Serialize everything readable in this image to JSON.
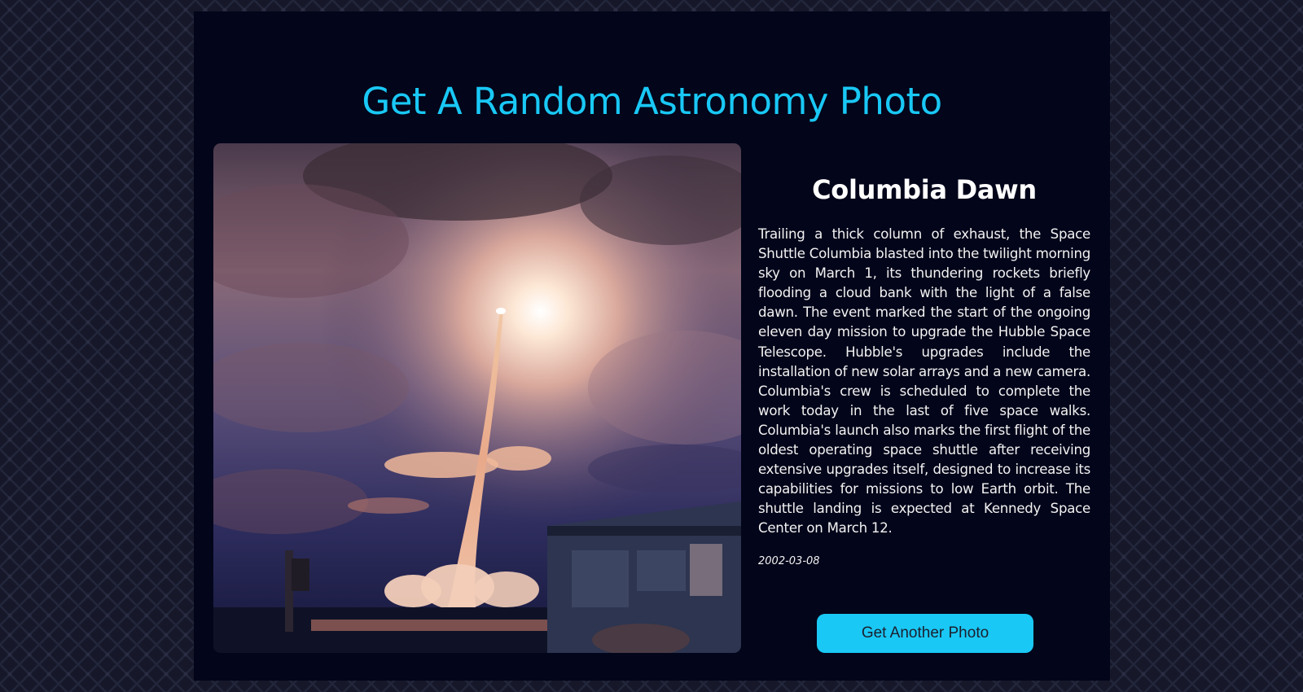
{
  "page": {
    "title": "Get A Random Astronomy Photo"
  },
  "apod": {
    "title": "Columbia Dawn",
    "explanation": "Trailing a thick column of exhaust, the Space Shuttle Columbia blasted into the twilight morning sky on March 1, its thundering rockets briefly flooding a cloud bank with the light of a false dawn. The event marked the start of the ongoing eleven day mission to upgrade the Hubble Space Telescope. Hubble's upgrades include the installation of new solar arrays and a new camera. Columbia's crew is scheduled to complete the work today in the last of five space walks. Columbia's launch also marks the first flight of the oldest operating space shuttle after receiving extensive upgrades itself, designed to increase its capabilities for missions to low Earth orbit. The shuttle landing is expected at Kennedy Space Center on March 12.",
    "date": "2002-03-08"
  },
  "actions": {
    "another_label": "Get Another Photo"
  },
  "colors": {
    "accent": "#19c8f5",
    "panel": "#03051a",
    "background": "#16182a"
  }
}
